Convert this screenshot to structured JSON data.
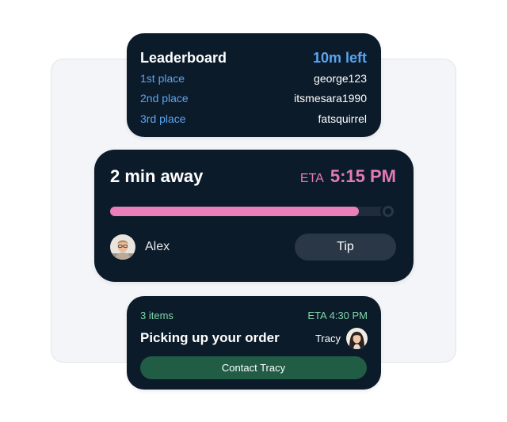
{
  "leaderboard": {
    "title": "Leaderboard",
    "time_left": "10m left",
    "entries": [
      {
        "place": "1st place",
        "name": "george123"
      },
      {
        "place": "2nd place",
        "name": "itsmesara1990"
      },
      {
        "place": "3rd place",
        "name": "fatsquirrel"
      }
    ]
  },
  "delivery": {
    "status": "2 min away",
    "eta_label": "ETA",
    "eta_time": "5:15 PM",
    "progress": 0.87,
    "driver_name": "Alex",
    "tip_label": "Tip"
  },
  "order": {
    "items": "3 items",
    "eta": "ETA 4:30 PM",
    "title": "Picking up your order",
    "shopper_name": "Tracy",
    "contact_label": "Contact Tracy"
  },
  "colors": {
    "card": "#0c1b2a",
    "blue_accent": "#5aa5f0",
    "pink_accent": "#ea7fb9",
    "green_accent": "#7fd6a8",
    "contact_button": "#215c45"
  }
}
